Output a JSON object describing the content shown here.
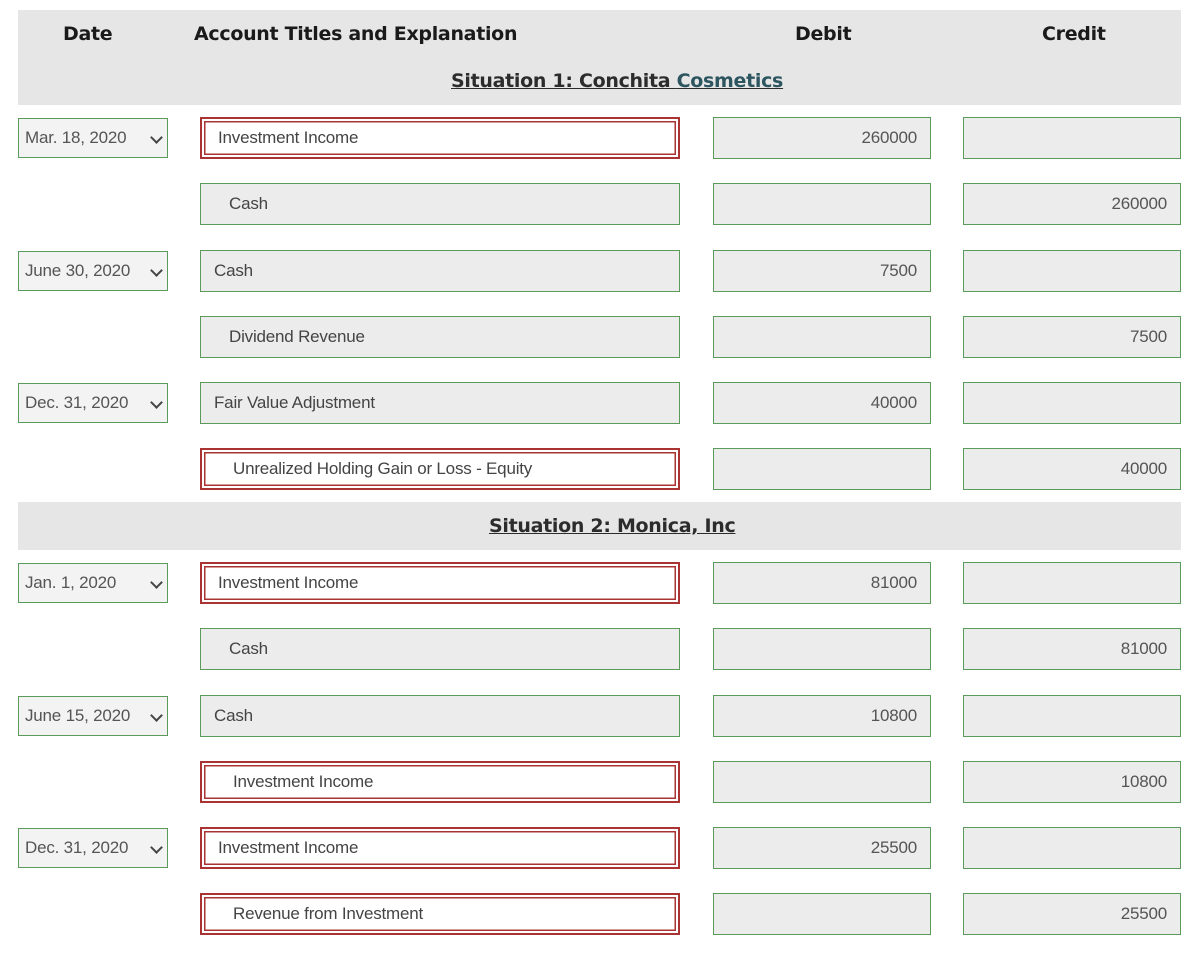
{
  "headers": {
    "date": "Date",
    "account": "Account Titles and Explanation",
    "debit": "Debit",
    "credit": "Credit"
  },
  "situation1": {
    "title_part1": "Situation 1: Conchita ",
    "title_part2": "Cosmetics"
  },
  "situation2": {
    "title": "Situation 2: Monica, Inc"
  },
  "colors": {
    "valid_border": "#5a9a5a",
    "error_border": "#a33333",
    "band": "#e6e6e6"
  },
  "entries": [
    {
      "date": "Mar. 18, 2020",
      "account": "Investment Income",
      "debit": "260000",
      "credit": "",
      "indent": false,
      "error": true
    },
    {
      "date": "",
      "account": "Cash",
      "debit": "",
      "credit": "260000",
      "indent": true,
      "error": false
    },
    {
      "date": "June 30, 2020",
      "account": "Cash",
      "debit": "7500",
      "credit": "",
      "indent": false,
      "error": false
    },
    {
      "date": "",
      "account": "Dividend Revenue",
      "debit": "",
      "credit": "7500",
      "indent": true,
      "error": false
    },
    {
      "date": "Dec. 31, 2020",
      "account": "Fair Value Adjustment",
      "debit": "40000",
      "credit": "",
      "indent": false,
      "error": false
    },
    {
      "date": "",
      "account": "Unrealized Holding Gain or Loss - Equity",
      "debit": "",
      "credit": "40000",
      "indent": true,
      "error": true
    },
    {
      "date": "Jan. 1, 2020",
      "account": "Investment Income",
      "debit": "81000",
      "credit": "",
      "indent": false,
      "error": true
    },
    {
      "date": "",
      "account": "Cash",
      "debit": "",
      "credit": "81000",
      "indent": true,
      "error": false
    },
    {
      "date": "June 15, 2020",
      "account": "Cash",
      "debit": "10800",
      "credit": "",
      "indent": false,
      "error": false
    },
    {
      "date": "",
      "account": "Investment Income",
      "debit": "",
      "credit": "10800",
      "indent": true,
      "error": true
    },
    {
      "date": "Dec. 31, 2020",
      "account": "Investment Income",
      "debit": "25500",
      "credit": "",
      "indent": false,
      "error": true
    },
    {
      "date": "",
      "account": "Revenue from Investment",
      "debit": "",
      "credit": "25500",
      "indent": true,
      "error": true
    }
  ]
}
